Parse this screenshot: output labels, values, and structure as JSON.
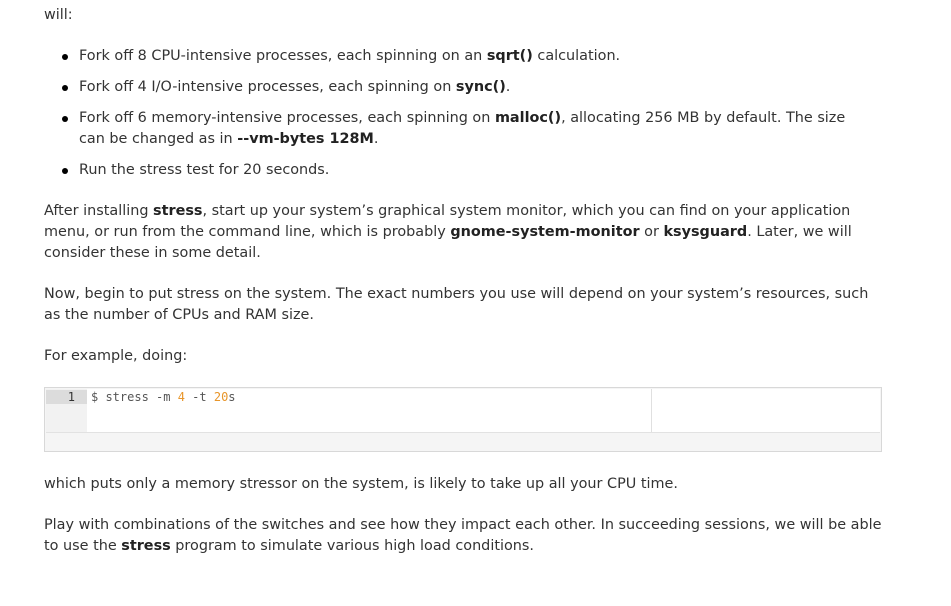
{
  "intro": "will:",
  "bullets": [
    {
      "pre": "Fork off 8 CPU-intensive processes, each spinning on an ",
      "bold": "sqrt()",
      "post": " calculation."
    },
    {
      "pre": "Fork off 4 I/O-intensive processes, each spinning on ",
      "bold": "sync()",
      "post": "."
    },
    {
      "pre": "Fork off 6 memory-intensive processes, each spinning on ",
      "bold": "malloc()",
      "post": ", allocating 256 MB by default. The size can be changed as in ",
      "bold2": "--vm-bytes 128M",
      "post2": "."
    },
    {
      "text": "Run the stress test for 20 seconds."
    }
  ],
  "para1": {
    "t1": "After installing ",
    "b1": "stress",
    "t2": ", start up your system’s graphical system monitor, which you can find on your application menu, or run from the command line, which is probably ",
    "b2": "gnome-system-monitor",
    "t3": " or ",
    "b3": "ksysguard",
    "t4": ". Later, we will consider these in some detail."
  },
  "para2": "Now, begin to put stress on the system. The exact numbers you use will depend on your system’s resources, such as the number of CPUs and RAM size.",
  "para3": "For example, doing:",
  "code": {
    "line_number": "1",
    "prefix": "$ stress -m ",
    "n1": "4",
    "mid": " -t ",
    "n2": "20",
    "suffix": "s"
  },
  "para4": "which puts only a memory stressor on the system, is likely to take up all your CPU time.",
  "para5": {
    "t1": "Play with combinations of the switches and see how they impact each other. In succeeding sessions, we will be able to use the ",
    "b1": "stress",
    "t2": " program to simulate various high load conditions."
  }
}
